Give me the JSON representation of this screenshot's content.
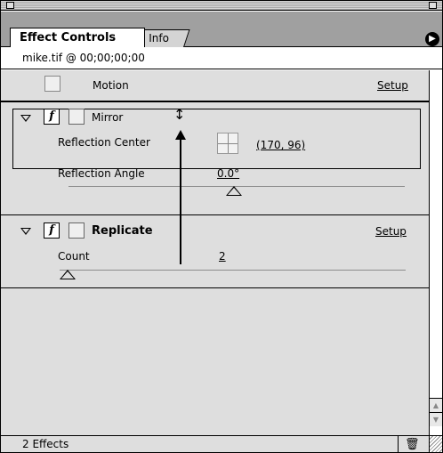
{
  "tabs": {
    "active": "Effect Controls",
    "other": "Info"
  },
  "clip": {
    "label": "mike.tif @ 00;00;00;00"
  },
  "motion": {
    "label": "Motion",
    "setup": "Setup"
  },
  "mirror": {
    "label": "Mirror",
    "fx": "f",
    "reflection_center_label": "Reflection Center",
    "reflection_center_value": "(170, 96)",
    "reflection_angle_label": "Reflection Angle",
    "reflection_angle_value": "0.0°"
  },
  "replicate": {
    "label": "Replicate",
    "fx": "f",
    "setup": "Setup",
    "count_label": "Count",
    "count_value": "2"
  },
  "footer": {
    "effects_count": "2 Effects"
  },
  "icons": {
    "menu": "▶",
    "trash": "🗑",
    "cursor": "↕"
  }
}
